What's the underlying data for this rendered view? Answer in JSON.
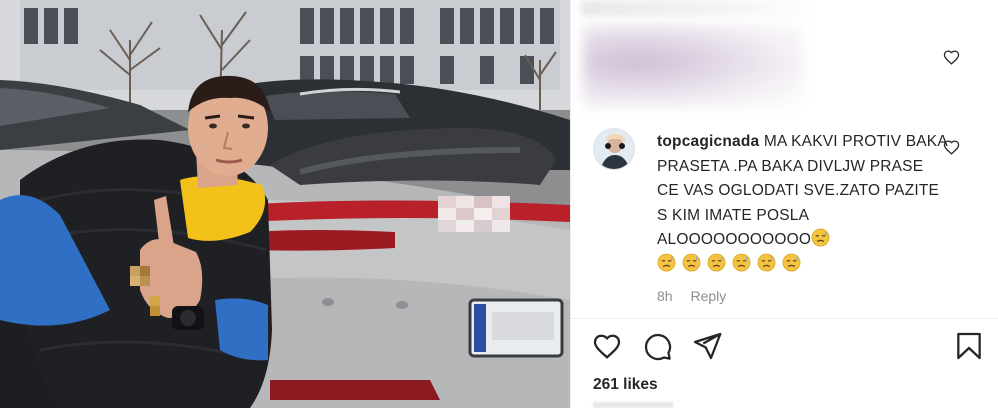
{
  "post": {
    "likes": "261 likes"
  },
  "comment": {
    "username": "topcagicnada",
    "text": "MA KAKVI PROTIV BAKA PRASETA .PA BAKA DIVLJW PRASE CE VAS OGLODATI SVE.ZATO PAZITE S KIM IMATE POSLA ALOOOOOOOOOOO",
    "emoji_count": 7,
    "emoji_name": "downcast-face-with-sweat-emoji",
    "time": "8h",
    "reply_label": "Reply"
  },
  "icons": {
    "comment_like": "heart-icon",
    "like": "heart-icon",
    "comment": "speech-bubble-icon",
    "share": "paper-plane-icon",
    "save": "bookmark-icon"
  },
  "colors": {
    "text": "#262626",
    "secondary": "#8e8e8e",
    "divider": "#efefef",
    "jacket_blue": "#2f6fc4",
    "jacket_yellow": "#f2c21a",
    "car_silver": "#b6b7b9",
    "taillight_red": "#b8202a"
  }
}
